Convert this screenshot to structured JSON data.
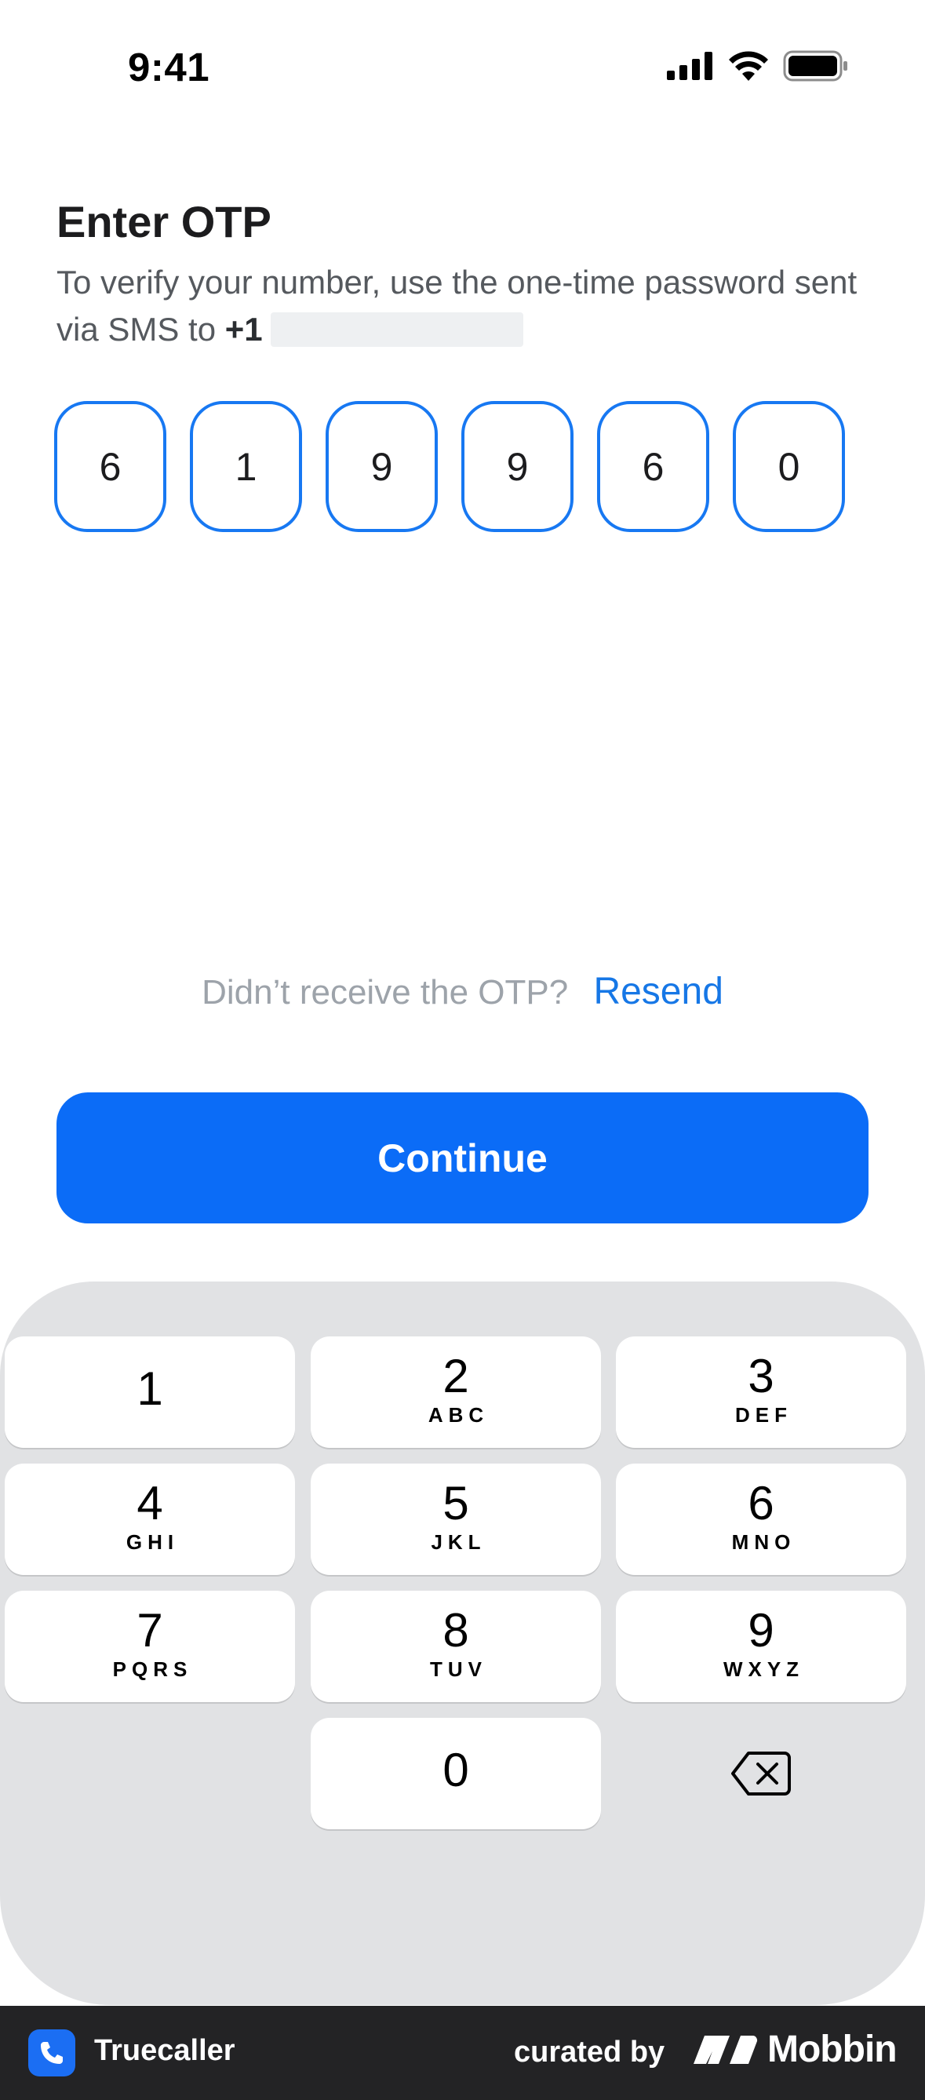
{
  "status_bar": {
    "time": "9:41",
    "icons": [
      "cellular-signal-icon",
      "wifi-icon",
      "battery-icon"
    ]
  },
  "header": {
    "title": "Enter OTP",
    "subtitle": "To verify your number, use the one-time password sent via SMS to",
    "phone_prefix": "+1"
  },
  "otp": {
    "digits": [
      "6",
      "1",
      "9",
      "9",
      "6",
      "0"
    ]
  },
  "resend": {
    "question": "Didn’t receive the OTP?",
    "link": "Resend"
  },
  "continue_label": "Continue",
  "keypad": {
    "keys": [
      {
        "num": "1",
        "letters": ""
      },
      {
        "num": "2",
        "letters": "ABC"
      },
      {
        "num": "3",
        "letters": "DEF"
      },
      {
        "num": "4",
        "letters": "GHI"
      },
      {
        "num": "5",
        "letters": "JKL"
      },
      {
        "num": "6",
        "letters": "MNO"
      },
      {
        "num": "7",
        "letters": "PQRS"
      },
      {
        "num": "8",
        "letters": "TUV"
      },
      {
        "num": "9",
        "letters": "WXYZ"
      },
      {
        "num": "0",
        "letters": ""
      }
    ],
    "backspace_icon": "backspace-icon"
  },
  "footer": {
    "app_name": "Truecaller",
    "curated_by": "curated by",
    "brand": "Mobbin"
  },
  "colors": {
    "accent": "#0b6cf7",
    "otp_border": "#1778f2",
    "link": "#1677e6",
    "keypad_bg": "#e1e2e4",
    "footer_bg": "#232325"
  }
}
